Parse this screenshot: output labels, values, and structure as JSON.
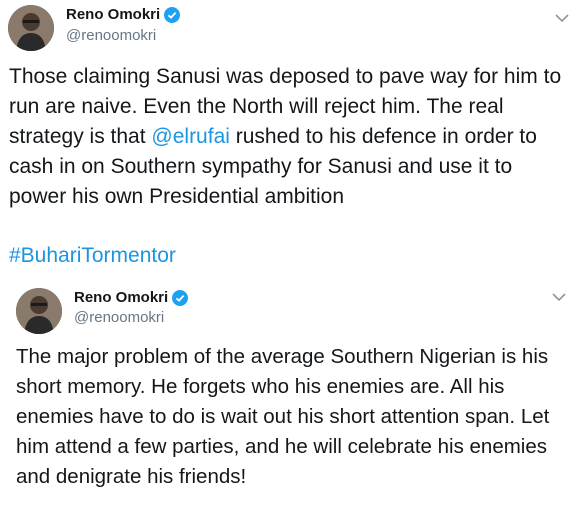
{
  "tweet": {
    "author_name": "Reno Omokri",
    "author_handle": "@renoomokri",
    "text_part1": "Those claiming Sanusi was deposed to pave way for him to run are naive. Even the North will reject him. The real strategy is that ",
    "mention": "@elrufai",
    "text_part2": " rushed to his defence in order to cash in on Southern sympathy for Sanusi and use it to power his own Presidential ambition",
    "hashtag": "#BuhariTormentor"
  },
  "quoted_tweet": {
    "author_name": "Reno Omokri",
    "author_handle": "@renoomokri",
    "text": "The major problem of the average Southern Nigerian is his short memory. He forgets who his enemies are. All his enemies have to do is wait out his short attention span. Let him attend a few parties, and he will celebrate his enemies and denigrate his friends!"
  },
  "colors": {
    "link": "#1b95e0",
    "verified": "#1da1f2",
    "secondary_text": "#657786"
  }
}
